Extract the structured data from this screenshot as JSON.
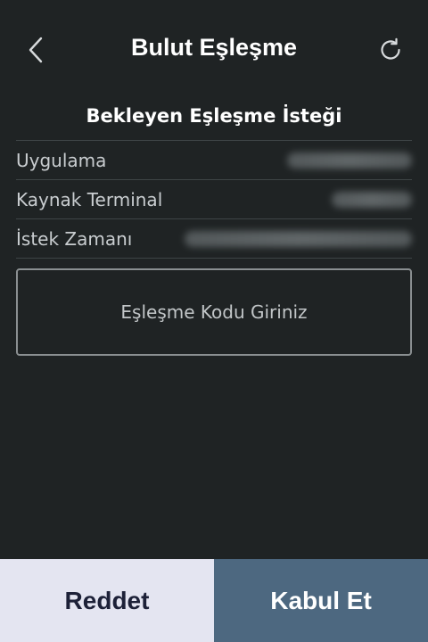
{
  "header": {
    "title": "Bulut Eşleşme",
    "back_icon": "chevron-left-icon",
    "refresh_icon": "refresh-icon"
  },
  "request": {
    "section_title": "Bekleyen Eşleşme İsteği",
    "rows": [
      {
        "label": "Uygulama"
      },
      {
        "label": "Kaynak Terminal"
      },
      {
        "label": "İstek Zamanı"
      }
    ]
  },
  "code_input": {
    "placeholder": "Eşleşme Kodu Giriniz"
  },
  "actions": {
    "reject_label": "Reddet",
    "accept_label": "Kabul Et"
  },
  "colors": {
    "background": "#1f2324",
    "reject_bg": "#e4e5f1",
    "accept_bg": "#4d6880"
  }
}
